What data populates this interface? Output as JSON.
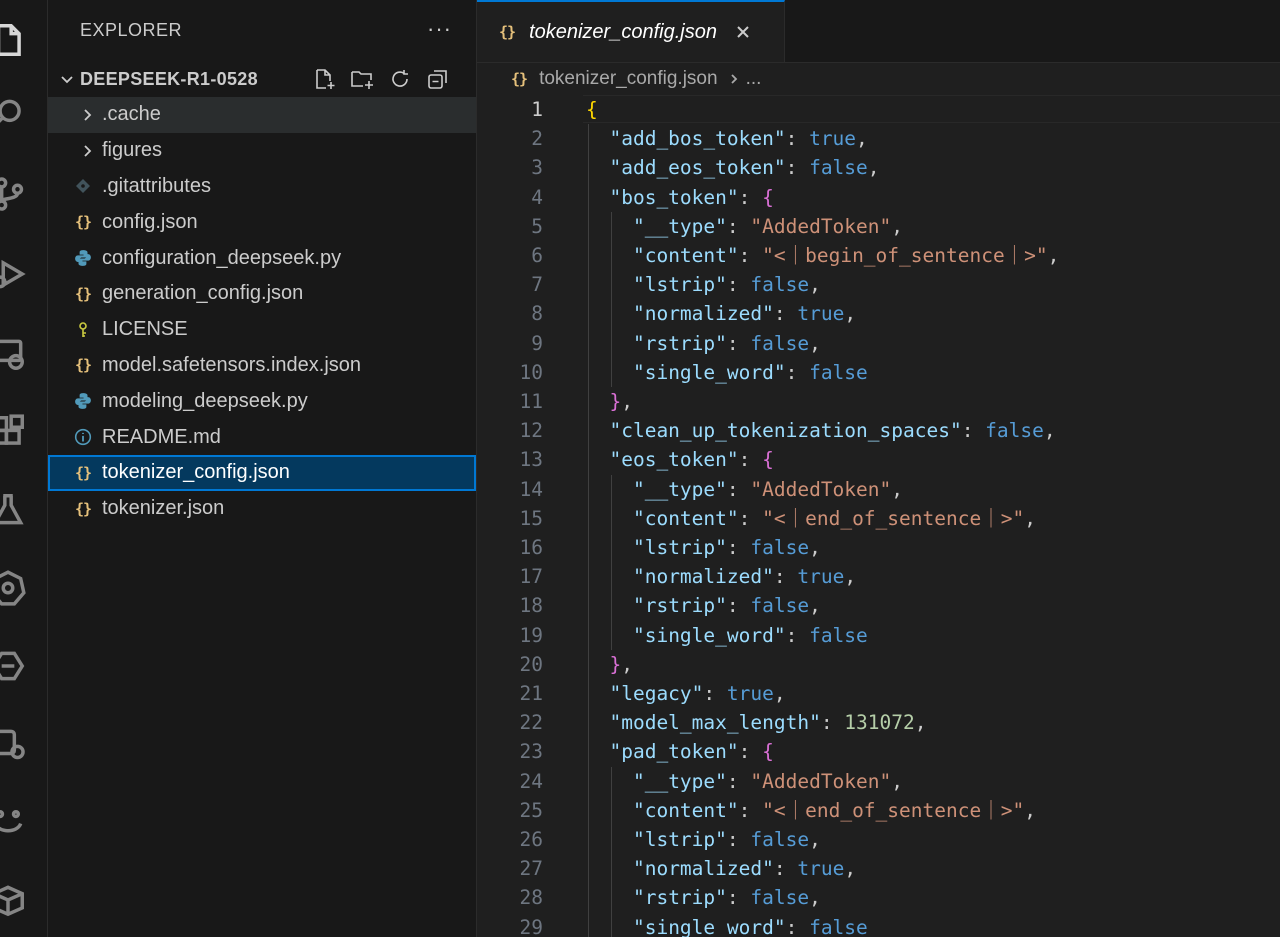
{
  "explorer": {
    "title": "EXPLORER",
    "more": "···",
    "folder": "DEEPSEEK-R1-0528",
    "items": [
      {
        "label": ".cache",
        "type": "folder"
      },
      {
        "label": "figures",
        "type": "folder"
      },
      {
        "label": ".gitattributes",
        "type": "git"
      },
      {
        "label": "config.json",
        "type": "json"
      },
      {
        "label": "configuration_deepseek.py",
        "type": "python"
      },
      {
        "label": "generation_config.json",
        "type": "json"
      },
      {
        "label": "LICENSE",
        "type": "license"
      },
      {
        "label": "model.safetensors.index.json",
        "type": "json"
      },
      {
        "label": "modeling_deepseek.py",
        "type": "python"
      },
      {
        "label": "README.md",
        "type": "info"
      },
      {
        "label": "tokenizer_config.json",
        "type": "json"
      },
      {
        "label": "tokenizer.json",
        "type": "json"
      }
    ],
    "selected": "tokenizer_config.json"
  },
  "tab": {
    "label": "tokenizer_config.json",
    "icon": "{}"
  },
  "breadcrumb": {
    "file": "tokenizer_config.json",
    "more": "..."
  },
  "code": {
    "current_line": 1,
    "lines": [
      [
        {
          "t": "{",
          "c": "br1"
        }
      ],
      [
        {
          "t": "  "
        },
        {
          "t": "\"add_bos_token\"",
          "c": "k"
        },
        {
          "t": ": "
        },
        {
          "t": "true",
          "c": "b"
        },
        {
          "t": ","
        }
      ],
      [
        {
          "t": "  "
        },
        {
          "t": "\"add_eos_token\"",
          "c": "k"
        },
        {
          "t": ": "
        },
        {
          "t": "false",
          "c": "b"
        },
        {
          "t": ","
        }
      ],
      [
        {
          "t": "  "
        },
        {
          "t": "\"bos_token\"",
          "c": "k"
        },
        {
          "t": ": "
        },
        {
          "t": "{",
          "c": "br2"
        }
      ],
      [
        {
          "t": "    "
        },
        {
          "t": "\"__type\"",
          "c": "k"
        },
        {
          "t": ": "
        },
        {
          "t": "\"AddedToken\"",
          "c": "s"
        },
        {
          "t": ","
        }
      ],
      [
        {
          "t": "    "
        },
        {
          "t": "\"content\"",
          "c": "k"
        },
        {
          "t": ": "
        },
        {
          "t": "\"<｜begin_of_sentence｜>\"",
          "c": "s"
        },
        {
          "t": ","
        }
      ],
      [
        {
          "t": "    "
        },
        {
          "t": "\"lstrip\"",
          "c": "k"
        },
        {
          "t": ": "
        },
        {
          "t": "false",
          "c": "b"
        },
        {
          "t": ","
        }
      ],
      [
        {
          "t": "    "
        },
        {
          "t": "\"normalized\"",
          "c": "k"
        },
        {
          "t": ": "
        },
        {
          "t": "true",
          "c": "b"
        },
        {
          "t": ","
        }
      ],
      [
        {
          "t": "    "
        },
        {
          "t": "\"rstrip\"",
          "c": "k"
        },
        {
          "t": ": "
        },
        {
          "t": "false",
          "c": "b"
        },
        {
          "t": ","
        }
      ],
      [
        {
          "t": "    "
        },
        {
          "t": "\"single_word\"",
          "c": "k"
        },
        {
          "t": ": "
        },
        {
          "t": "false",
          "c": "b"
        }
      ],
      [
        {
          "t": "  "
        },
        {
          "t": "}",
          "c": "br2"
        },
        {
          "t": ","
        }
      ],
      [
        {
          "t": "  "
        },
        {
          "t": "\"clean_up_tokenization_spaces\"",
          "c": "k"
        },
        {
          "t": ": "
        },
        {
          "t": "false",
          "c": "b"
        },
        {
          "t": ","
        }
      ],
      [
        {
          "t": "  "
        },
        {
          "t": "\"eos_token\"",
          "c": "k"
        },
        {
          "t": ": "
        },
        {
          "t": "{",
          "c": "br2"
        }
      ],
      [
        {
          "t": "    "
        },
        {
          "t": "\"__type\"",
          "c": "k"
        },
        {
          "t": ": "
        },
        {
          "t": "\"AddedToken\"",
          "c": "s"
        },
        {
          "t": ","
        }
      ],
      [
        {
          "t": "    "
        },
        {
          "t": "\"content\"",
          "c": "k"
        },
        {
          "t": ": "
        },
        {
          "t": "\"<｜end_of_sentence｜>\"",
          "c": "s"
        },
        {
          "t": ","
        }
      ],
      [
        {
          "t": "    "
        },
        {
          "t": "\"lstrip\"",
          "c": "k"
        },
        {
          "t": ": "
        },
        {
          "t": "false",
          "c": "b"
        },
        {
          "t": ","
        }
      ],
      [
        {
          "t": "    "
        },
        {
          "t": "\"normalized\"",
          "c": "k"
        },
        {
          "t": ": "
        },
        {
          "t": "true",
          "c": "b"
        },
        {
          "t": ","
        }
      ],
      [
        {
          "t": "    "
        },
        {
          "t": "\"rstrip\"",
          "c": "k"
        },
        {
          "t": ": "
        },
        {
          "t": "false",
          "c": "b"
        },
        {
          "t": ","
        }
      ],
      [
        {
          "t": "    "
        },
        {
          "t": "\"single_word\"",
          "c": "k"
        },
        {
          "t": ": "
        },
        {
          "t": "false",
          "c": "b"
        }
      ],
      [
        {
          "t": "  "
        },
        {
          "t": "}",
          "c": "br2"
        },
        {
          "t": ","
        }
      ],
      [
        {
          "t": "  "
        },
        {
          "t": "\"legacy\"",
          "c": "k"
        },
        {
          "t": ": "
        },
        {
          "t": "true",
          "c": "b"
        },
        {
          "t": ","
        }
      ],
      [
        {
          "t": "  "
        },
        {
          "t": "\"model_max_length\"",
          "c": "k"
        },
        {
          "t": ": "
        },
        {
          "t": "131072",
          "c": "n"
        },
        {
          "t": ","
        }
      ],
      [
        {
          "t": "  "
        },
        {
          "t": "\"pad_token\"",
          "c": "k"
        },
        {
          "t": ": "
        },
        {
          "t": "{",
          "c": "br2"
        }
      ],
      [
        {
          "t": "    "
        },
        {
          "t": "\"__type\"",
          "c": "k"
        },
        {
          "t": ": "
        },
        {
          "t": "\"AddedToken\"",
          "c": "s"
        },
        {
          "t": ","
        }
      ],
      [
        {
          "t": "    "
        },
        {
          "t": "\"content\"",
          "c": "k"
        },
        {
          "t": ": "
        },
        {
          "t": "\"<｜end_of_sentence｜>\"",
          "c": "s"
        },
        {
          "t": ","
        }
      ],
      [
        {
          "t": "    "
        },
        {
          "t": "\"lstrip\"",
          "c": "k"
        },
        {
          "t": ": "
        },
        {
          "t": "false",
          "c": "b"
        },
        {
          "t": ","
        }
      ],
      [
        {
          "t": "    "
        },
        {
          "t": "\"normalized\"",
          "c": "k"
        },
        {
          "t": ": "
        },
        {
          "t": "true",
          "c": "b"
        },
        {
          "t": ","
        }
      ],
      [
        {
          "t": "    "
        },
        {
          "t": "\"rstrip\"",
          "c": "k"
        },
        {
          "t": ": "
        },
        {
          "t": "false",
          "c": "b"
        },
        {
          "t": ","
        }
      ],
      [
        {
          "t": "    "
        },
        {
          "t": "\"single_word\"",
          "c": "k"
        },
        {
          "t": ": "
        },
        {
          "t": "false",
          "c": "b"
        }
      ]
    ]
  },
  "colors": {
    "key": "#9cdcfe",
    "string": "#ce9178",
    "boolean": "#569cd6",
    "number": "#b5cea8",
    "bracket1": "#ffd700",
    "bracket2": "#da70d6",
    "accent": "#0078d4",
    "selection": "#04395e"
  }
}
